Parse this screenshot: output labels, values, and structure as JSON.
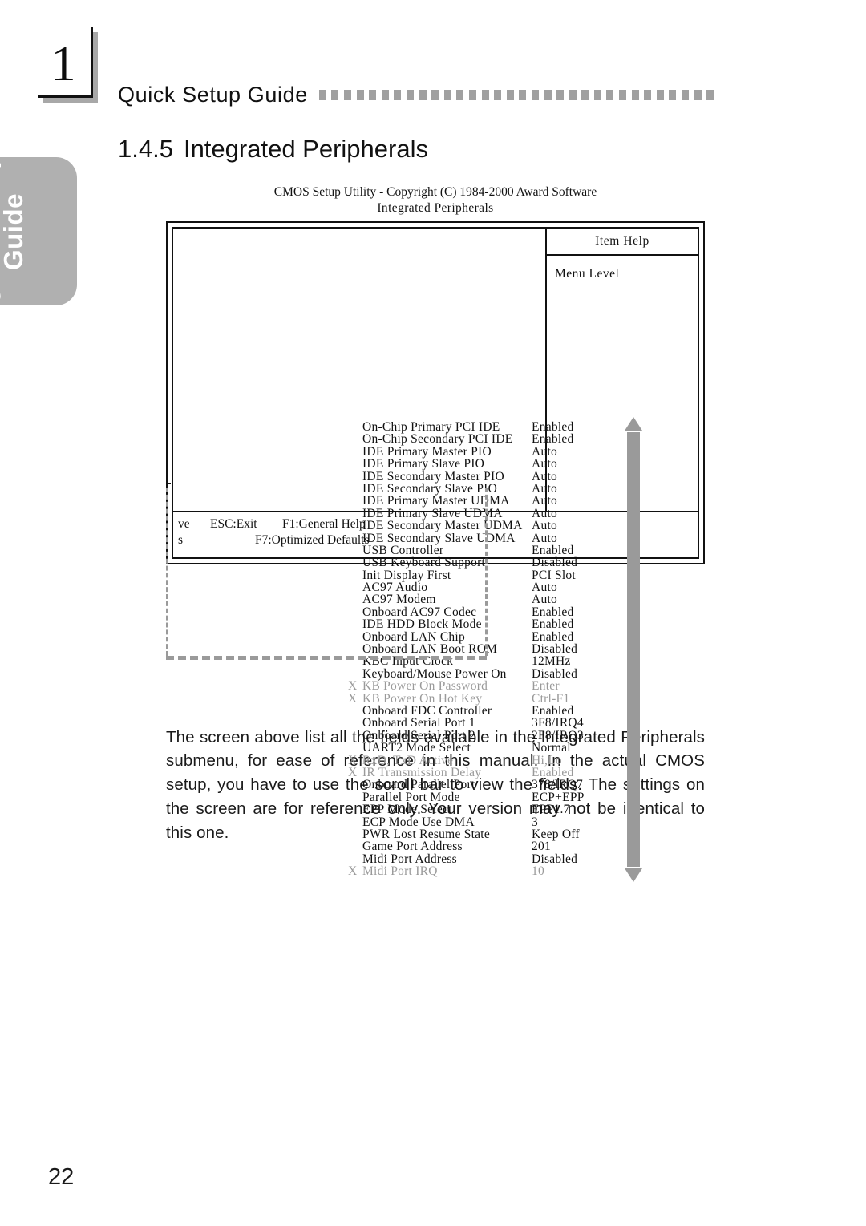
{
  "chapter": {
    "number": "1"
  },
  "running_head": {
    "text": "Quick Setup Guide",
    "dot_count": 32
  },
  "side_tab": {
    "label": "Quick Setup\nGuide"
  },
  "section": {
    "number": "1.4.5",
    "title": "Integrated Peripherals"
  },
  "bios": {
    "title_line1": "CMOS Setup Utility - Copyright (C) 1984-2000 Award Software",
    "title_line2": "Integrated  Peripherals",
    "item_help": {
      "header": "Item  Help",
      "menu_level": "Menu  Level"
    },
    "footer": {
      "row1_left": "ve",
      "row1_esc": "ESC:Exit",
      "row1_f1": "F1:General  Help",
      "row2_left": "s",
      "row2_f7": "F7:Optimized  Defaults"
    },
    "settings": [
      {
        "x": "",
        "label": "On-Chip Primary PCI IDE",
        "value": "Enabled",
        "dim": false
      },
      {
        "x": "",
        "label": "On-Chip Secondary PCI IDE",
        "value": "Enabled",
        "dim": false
      },
      {
        "x": "",
        "label": "IDE Primary Master PIO",
        "value": "Auto",
        "dim": false
      },
      {
        "x": "",
        "label": "IDE Primary Slave PIO",
        "value": "Auto",
        "dim": false
      },
      {
        "x": "",
        "label": "IDE Secondary Master PIO",
        "value": "Auto",
        "dim": false
      },
      {
        "x": "",
        "label": "IDE Secondary Slave PIO",
        "value": "Auto",
        "dim": false
      },
      {
        "x": "",
        "label": "IDE Primary Master UDMA",
        "value": "Auto",
        "dim": false
      },
      {
        "x": "",
        "label": "IDE Primary Slave UDMA",
        "value": "Auto",
        "dim": false
      },
      {
        "x": "",
        "label": "IDE Secondary Master UDMA",
        "value": "Auto",
        "dim": false
      },
      {
        "x": "",
        "label": "IDE Secondary Slave UDMA",
        "value": "Auto",
        "dim": false
      },
      {
        "x": "",
        "label": "USB Controller",
        "value": "Enabled",
        "dim": false
      },
      {
        "x": "",
        "label": "USB Keyboard Support",
        "value": "Disabled",
        "dim": false
      },
      {
        "x": "",
        "label": "Init Display First",
        "value": "PCI Slot",
        "dim": false
      },
      {
        "x": "",
        "label": "AC97 Audio",
        "value": "Auto",
        "dim": false
      },
      {
        "x": "",
        "label": "AC97 Modem",
        "value": "Auto",
        "dim": false
      },
      {
        "x": "",
        "label": "Onboard AC97 Codec",
        "value": "Enabled",
        "dim": false
      },
      {
        "x": "",
        "label": "IDE HDD Block Mode",
        "value": "Enabled",
        "dim": false
      },
      {
        "x": "",
        "label": "Onboard LAN Chip",
        "value": "Enabled",
        "dim": false
      },
      {
        "x": "",
        "label": "Onboard LAN Boot ROM",
        "value": "Disabled",
        "dim": false
      },
      {
        "x": "",
        "label": "KBC Input Clock",
        "value": "12MHz",
        "dim": false
      },
      {
        "x": "",
        "label": "Keyboard/Mouse Power On",
        "value": "Disabled",
        "dim": false
      },
      {
        "x": "X",
        "label": "KB Power On Password",
        "value": "Enter",
        "dim": true
      },
      {
        "x": "X",
        "label": "KB Power On Hot Key",
        "value": "Ctrl-F1",
        "dim": true
      },
      {
        "x": "",
        "label": "Onboard FDC Controller",
        "value": "Enabled",
        "dim": false
      },
      {
        "x": "",
        "label": "Onboard Serial Port 1",
        "value": "3F8/IRQ4",
        "dim": false
      },
      {
        "x": "",
        "label": "Onboard Serial Port 2",
        "value": "2F8/IRQ3",
        "dim": false
      },
      {
        "x": "",
        "label": "UART2 Mode Select",
        "value": "Normal",
        "dim": false
      },
      {
        "x": "X",
        "label": "RxD, TxD Active",
        "value": "Hi,Lo",
        "dim": true
      },
      {
        "x": "X",
        "label": "IR Transmission Delay",
        "value": "Enabled",
        "dim": true
      },
      {
        "x": "",
        "label": "Onboard Parallel Port",
        "value": "378/IRQ7",
        "dim": false
      },
      {
        "x": "",
        "label": "Parallel Port Mode",
        "value": "ECP+EPP",
        "dim": false
      },
      {
        "x": "",
        "label": "EPP Mode Select",
        "value": "EPP1.7",
        "dim": false
      },
      {
        "x": "",
        "label": "ECP Mode Use DMA",
        "value": "3",
        "dim": false
      },
      {
        "x": "",
        "label": "PWR Lost Resume State",
        "value": "Keep  Off",
        "dim": false
      },
      {
        "x": "",
        "label": "Game Port Address",
        "value": "201",
        "dim": false
      },
      {
        "x": "",
        "label": "Midi Port Address",
        "value": "Disabled",
        "dim": false
      },
      {
        "x": "X",
        "label": "Midi Port IRQ",
        "value": "10",
        "dim": true
      }
    ]
  },
  "body_paragraph": "The screen above list all the fields available in the Integrated Peripherals submenu, for ease of reference in this manual. In the actual CMOS setup, you have to use the scroll bar to view the fields. The settings on the screen are for reference only. Your version may not be identical to this one.",
  "page_number": "22",
  "colors": {
    "tab_gray": "#b0b0b0",
    "dot_gray": "#a0a0a0",
    "scrollbar_gray": "#9a9a9a",
    "dim_text": "#9a9a9a",
    "ink": "#111111"
  }
}
